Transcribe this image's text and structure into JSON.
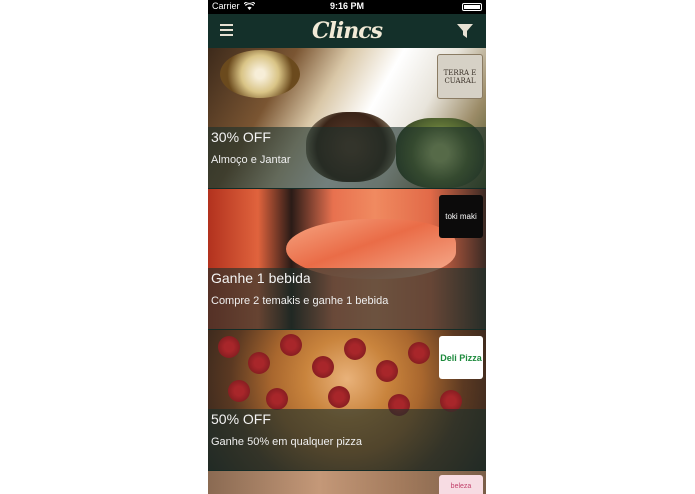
{
  "status_bar": {
    "carrier": "Carrier",
    "time": "9:16 PM"
  },
  "nav": {
    "logo_text": "Clincs",
    "menu_icon": "hamburger-menu-icon",
    "filter_icon": "filter-funnel-icon"
  },
  "offers": [
    {
      "title": "30% OFF",
      "subtitle": "Almoço e Jantar",
      "brand_logo_text": "TERRA E CUARAL"
    },
    {
      "title": "Ganhe 1 bebida",
      "subtitle": "Compre 2 temakis e ganhe 1 bebida",
      "brand_logo_text": "toki maki"
    },
    {
      "title": "50% OFF",
      "subtitle": "Ganhe 50% em qualquer pizza",
      "brand_logo_text": "Deli Pizza"
    },
    {
      "title": "",
      "subtitle": "",
      "brand_logo_text": "beleza"
    }
  ],
  "colors": {
    "nav_background": "#14302a",
    "overlay": "#1c302c",
    "logo": "#f1ead7"
  }
}
